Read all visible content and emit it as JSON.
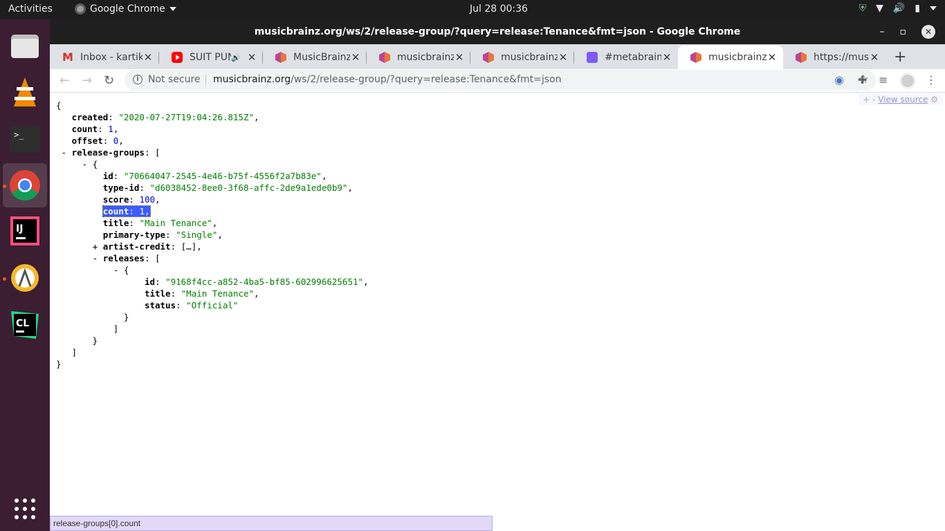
{
  "topbar": {
    "activities": "Activities",
    "app_name": "Google Chrome",
    "clock": "Jul 28  00:36"
  },
  "window": {
    "title": "musicbrainz.org/ws/2/release-group/?query=release:Tenance&fmt=json - Google Chrome"
  },
  "tabs": [
    {
      "label": "Inbox - kartik",
      "icon": "gmail-icon"
    },
    {
      "label": "SUIT PUN",
      "icon": "youtube-icon",
      "audio": "🔊"
    },
    {
      "label": "MusicBrainz",
      "icon": "musicbrainz-icon"
    },
    {
      "label": "musicbrainz",
      "icon": "musicbrainz-icon"
    },
    {
      "label": "musicbrainz",
      "icon": "musicbrainz-icon"
    },
    {
      "label": "#metabrainz",
      "icon": "matrix-icon"
    },
    {
      "label": "musicbrainz",
      "icon": "musicbrainz-icon",
      "active": true
    },
    {
      "label": "https://musi",
      "icon": "musicbrainz-icon"
    }
  ],
  "toolbar": {
    "not_secure": "Not secure",
    "url_host": "musicbrainz.org",
    "url_path": "/ws/2/release-group/?query=release:Tenance&fmt=json"
  },
  "json_view": {
    "created_key": "created",
    "created_val": "\"2020-07-27T19:04:26.815Z\"",
    "count_key": "count",
    "count_val": "1",
    "offset_key": "offset",
    "offset_val": "0",
    "rg_key": "release-groups",
    "rg": {
      "id_key": "id",
      "id_val": "\"70664047-2545-4e46-b75f-4556f2a7b83e\"",
      "typeid_key": "type-id",
      "typeid_val": "\"d6038452-8ee0-3f68-affc-2de9a1ede0b9\"",
      "score_key": "score",
      "score_val": "100",
      "count_key": "count",
      "count_val": "1",
      "title_key": "title",
      "title_val": "\"Main Tenance\"",
      "ptype_key": "primary-type",
      "ptype_val": "\"Single\"",
      "ac_key": "artist-credit",
      "ac_val": "[…]",
      "releases_key": "releases",
      "release": {
        "id_key": "id",
        "id_val": "\"9168f4cc-a852-4ba5-bf85-602996625651\"",
        "title_key": "title",
        "title_val": "\"Main Tenance\"",
        "status_key": "status",
        "status_val": "\"Official\""
      }
    },
    "view_source": "View source",
    "toggles": "+ -"
  },
  "status_bar": "release-groups[0].count",
  "colors": {
    "string": "#008000",
    "number": "#0000cc",
    "selection": "#3d5bff",
    "dock_bg": "#3b1e32",
    "dock_indicator": "#e95420"
  }
}
